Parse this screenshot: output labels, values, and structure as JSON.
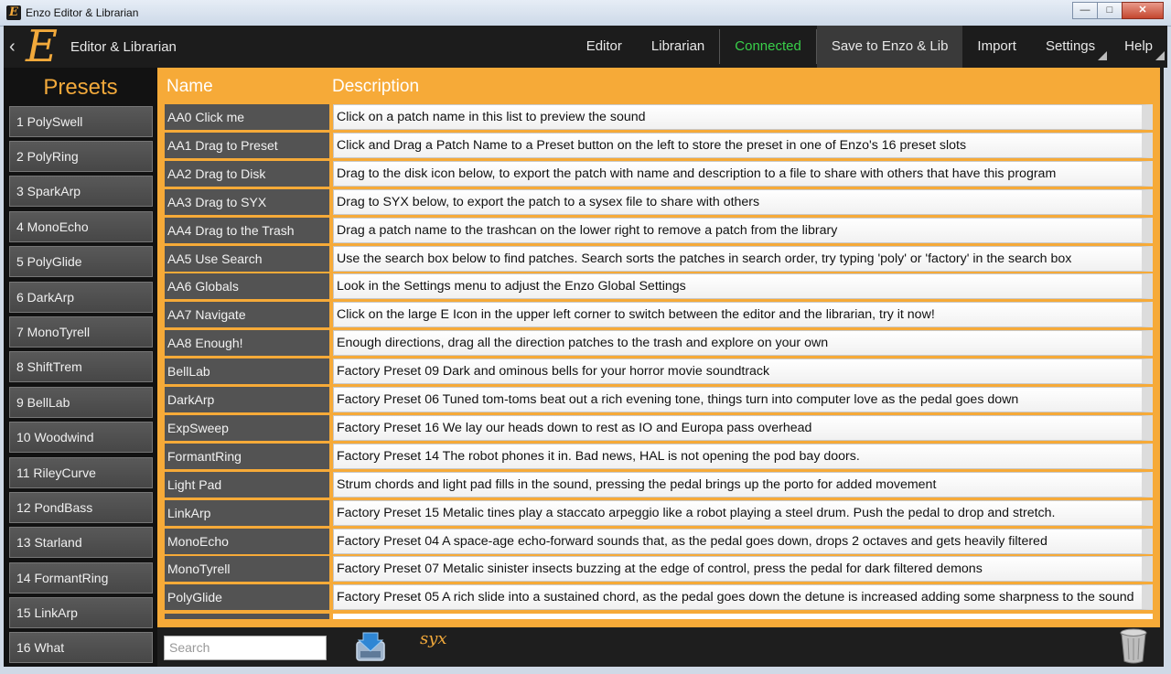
{
  "window": {
    "title": "Enzo Editor & Librarian",
    "minimize": "—",
    "maximize": "□",
    "close": "✕"
  },
  "header": {
    "logo": "E",
    "title": "Editor & Librarian",
    "nav": {
      "editor": "Editor",
      "librarian": "Librarian",
      "connected": "Connected",
      "save": "Save to Enzo & Lib",
      "import": "Import",
      "settings": "Settings",
      "help": "Help"
    }
  },
  "presets": {
    "heading": "Presets",
    "items": [
      "1 PolySwell",
      "2 PolyRing",
      "3 SparkArp",
      "4 MonoEcho",
      "5 PolyGlide",
      "6 DarkArp",
      "7 MonoTyrell",
      "8 ShiftTrem",
      "9 BellLab",
      "10 Woodwind",
      "11 RileyCurve",
      "12 PondBass",
      "13 Starland",
      "14 FormantRing",
      "15 LinkArp",
      "16 What"
    ]
  },
  "library": {
    "columns": {
      "name": "Name",
      "description": "Description"
    },
    "rows": [
      {
        "name": "AA0 Click me",
        "desc": "Click on a patch name in this list to preview the sound"
      },
      {
        "name": "AA1 Drag to Preset",
        "desc": "Click and Drag a Patch Name to a Preset button on the left to store the preset in one of Enzo's 16 preset slots"
      },
      {
        "name": "AA2 Drag to Disk",
        "desc": "Drag to the disk icon below,  to export the patch with name and description to a file to share with others that have this program"
      },
      {
        "name": "AA3 Drag to SYX",
        "desc": "Drag to SYX below, to export the patch to a sysex file to share with others"
      },
      {
        "name": "AA4 Drag to the Trash",
        "desc": "Drag a patch name to the trashcan on the lower right to remove a patch from the library"
      },
      {
        "name": "AA5 Use Search",
        "desc": "Use the search box below to find patches.  Search sorts the patches in search order, try typing 'poly' or 'factory' in the search box"
      },
      {
        "name": "AA6 Globals",
        "desc": "Look in the Settings menu to adjust the Enzo Global Settings"
      },
      {
        "name": "AA7 Navigate",
        "desc": "Click on the large E Icon in the upper left corner to switch between the editor and the librarian, try it now!"
      },
      {
        "name": "AA8 Enough!",
        "desc": "Enough directions, drag all the direction patches to the trash and explore on your own"
      },
      {
        "name": "BellLab",
        "desc": "Factory Preset 09 Dark and ominous bells for your horror movie soundtrack"
      },
      {
        "name": "DarkArp",
        "desc": "Factory Preset 06 Tuned tom-toms beat out a rich evening tone, things turn into computer love as the pedal goes down"
      },
      {
        "name": "ExpSweep",
        "desc": "Factory Preset 16 We lay our heads down to rest as IO and Europa pass overhead"
      },
      {
        "name": "FormantRing",
        "desc": "Factory Preset 14 The robot phones it in.  Bad news, HAL is not opening the pod bay doors."
      },
      {
        "name": "Light Pad",
        "desc": "Strum chords and light pad fills in the sound, pressing the pedal brings up the porto for added movement"
      },
      {
        "name": "LinkArp",
        "desc": "Factory Preset 15 Metalic tines play a staccato arpeggio like a robot playing a steel drum. Push the pedal to drop and stretch."
      },
      {
        "name": "MonoEcho",
        "desc": "Factory Preset 04 A space-age echo-forward sounds that, as the pedal goes down, drops 2 octaves and gets heavily filtered"
      },
      {
        "name": "MonoTyrell",
        "desc": "Factory Preset 07 Metalic sinister insects buzzing at the edge of control, press the pedal for dark filtered demons"
      },
      {
        "name": "PolyGlide",
        "desc": "Factory Preset 05 A rich slide into a sustained chord, as the pedal goes down the detune is increased adding some sharpness to the sound"
      }
    ]
  },
  "footer": {
    "search_placeholder": "Search",
    "syx_label": "syx"
  }
}
